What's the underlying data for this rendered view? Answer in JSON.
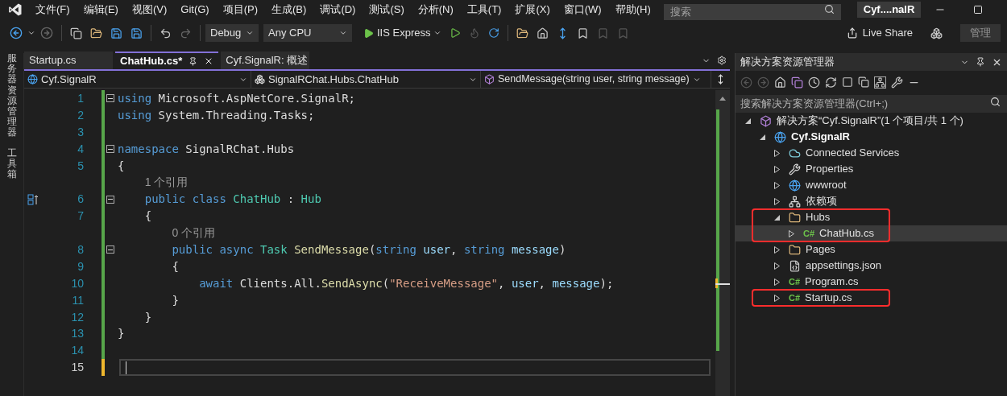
{
  "title_bar": {
    "menus": [
      "文件(F)",
      "编辑(E)",
      "视图(V)",
      "Git(G)",
      "项目(P)",
      "生成(B)",
      "调试(D)",
      "测试(S)",
      "分析(N)",
      "工具(T)",
      "扩展(X)",
      "窗口(W)",
      "帮助(H)"
    ],
    "search": {
      "placeholder": "搜索"
    },
    "solution_name": "Cyf....nalR"
  },
  "toolbar": {
    "configuration": "Debug",
    "platform": "Any CPU",
    "run_target": "IIS Express",
    "live_share": "Live Share",
    "admin": "管理"
  },
  "side_tabs": [
    "服务器资源管理器",
    "工具箱"
  ],
  "editor": {
    "tabs": [
      {
        "label": "Startup.cs",
        "selected": false
      },
      {
        "label": "ChatHub.cs*",
        "selected": true
      },
      {
        "label": "Cyf.SignalR: 概述",
        "selected": false
      }
    ],
    "nav": {
      "project": "Cyf.SignalR",
      "type": "SignalRChat.Hubs.ChatHub",
      "member": "SendMessage(string user, string message)"
    },
    "lines": [
      {
        "kind": "code",
        "number": "1",
        "saved": true,
        "foldable": true,
        "current": false,
        "tokens": [
          {
            "kind": "kw",
            "text": "using"
          },
          {
            "kind": "plain",
            "text": " Microsoft.AspNetCore.SignalR;"
          }
        ]
      },
      {
        "kind": "code",
        "number": "2",
        "saved": true,
        "foldable": false,
        "current": false,
        "tokens": [
          {
            "kind": "kw",
            "text": "using"
          },
          {
            "kind": "plain",
            "text": " System.Threading.Tasks;"
          }
        ]
      },
      {
        "kind": "code",
        "number": "3",
        "saved": true,
        "foldable": false,
        "current": false
      },
      {
        "kind": "code",
        "number": "4",
        "saved": true,
        "foldable": true,
        "current": false,
        "tokens": [
          {
            "kind": "kw",
            "text": "namespace"
          },
          {
            "kind": "plain",
            "text": " SignalRChat.Hubs"
          }
        ]
      },
      {
        "kind": "code",
        "number": "5",
        "saved": true,
        "foldable": false,
        "current": false,
        "tokens": [
          {
            "kind": "plain",
            "text": "{"
          }
        ]
      },
      {
        "kind": "lens",
        "text": "1 个引用"
      },
      {
        "kind": "code",
        "number": "6",
        "saved": true,
        "foldable": true,
        "current": false,
        "gutter_icon": true,
        "tokens": [
          {
            "kind": "kw",
            "text": "    public class"
          },
          {
            "kind": "type",
            "text": " ChatHub"
          },
          {
            "kind": "plain",
            "text": " : "
          },
          {
            "kind": "type",
            "text": "Hub"
          }
        ]
      },
      {
        "kind": "code",
        "number": "7",
        "saved": true,
        "foldable": false,
        "current": false,
        "tokens": [
          {
            "kind": "plain",
            "text": "    {"
          }
        ]
      },
      {
        "kind": "lens",
        "text": "0 个引用"
      },
      {
        "kind": "code",
        "number": "8",
        "saved": true,
        "foldable": true,
        "current": false,
        "tokens": [
          {
            "kind": "kw",
            "text": "        public async"
          },
          {
            "kind": "type",
            "text": " Task"
          },
          {
            "kind": "method",
            "text": " SendMessage"
          },
          {
            "kind": "plain",
            "text": "("
          },
          {
            "kind": "kw",
            "text": "string"
          },
          {
            "kind": "param",
            "text": " user"
          },
          {
            "kind": "plain",
            "text": ", "
          },
          {
            "kind": "kw",
            "text": "string"
          },
          {
            "kind": "param",
            "text": " message"
          },
          {
            "kind": "plain",
            "text": ")"
          }
        ]
      },
      {
        "kind": "code",
        "number": "9",
        "saved": true,
        "foldable": false,
        "current": false,
        "tokens": [
          {
            "kind": "plain",
            "text": "        {"
          }
        ]
      },
      {
        "kind": "code",
        "number": "10",
        "saved": true,
        "foldable": false,
        "current": false,
        "tokens": [
          {
            "kind": "kw",
            "text": "            await"
          },
          {
            "kind": "plain",
            "text": " Clients.All."
          },
          {
            "kind": "method",
            "text": "SendAsync"
          },
          {
            "kind": "plain",
            "text": "("
          },
          {
            "kind": "str",
            "text": "\"ReceiveMessage\""
          },
          {
            "kind": "plain",
            "text": ", "
          },
          {
            "kind": "param",
            "text": "user"
          },
          {
            "kind": "plain",
            "text": ", "
          },
          {
            "kind": "param",
            "text": "message"
          },
          {
            "kind": "plain",
            "text": ");"
          }
        ]
      },
      {
        "kind": "code",
        "number": "11",
        "saved": true,
        "foldable": false,
        "current": false,
        "tokens": [
          {
            "kind": "plain",
            "text": "        }"
          }
        ]
      },
      {
        "kind": "code",
        "number": "12",
        "saved": true,
        "foldable": false,
        "current": false,
        "tokens": [
          {
            "kind": "plain",
            "text": "    }"
          }
        ]
      },
      {
        "kind": "code",
        "number": "13",
        "saved": true,
        "foldable": false,
        "current": false,
        "tokens": [
          {
            "kind": "plain",
            "text": "}"
          }
        ]
      },
      {
        "kind": "code",
        "number": "14",
        "saved": true,
        "foldable": false,
        "current": false
      },
      {
        "kind": "code",
        "number": "15",
        "saved": false,
        "foldable": false,
        "current": true
      }
    ]
  },
  "solution_explorer": {
    "title": "解决方案资源管理器",
    "search": {
      "placeholder": "搜索解决方案资源管理器(Ctrl+;)"
    },
    "tree": [
      {
        "label": "解决方案“Cyf.SignalR”(1 个项目/共 1 个)",
        "kind": "solution",
        "expanded": true,
        "selected": false,
        "highlighted": false,
        "children": [
          {
            "label": "Cyf.SignalR",
            "kind": "project",
            "expanded": true,
            "selected": false,
            "highlighted": false,
            "children": [
              {
                "label": "Connected Services",
                "kind": "connected",
                "expanded": false,
                "selected": false,
                "highlighted": false
              },
              {
                "label": "Properties",
                "kind": "properties",
                "expanded": false,
                "selected": false,
                "highlighted": false
              },
              {
                "label": "wwwroot",
                "kind": "globe",
                "expanded": false,
                "selected": false,
                "highlighted": false
              },
              {
                "label": "依赖项",
                "kind": "deps",
                "expanded": false,
                "selected": false,
                "highlighted": false
              },
              {
                "label": "Hubs",
                "kind": "folder",
                "expanded": true,
                "selected": false,
                "highlighted": true,
                "children": [
                  {
                    "label": "ChatHub.cs",
                    "kind": "csharp",
                    "icon_text": "C#",
                    "expanded": false,
                    "selected": true,
                    "highlighted": false
                  }
                ]
              },
              {
                "label": "Pages",
                "kind": "folder",
                "expanded": false,
                "selected": false,
                "highlighted": false
              },
              {
                "label": "appsettings.json",
                "kind": "json",
                "expanded": false,
                "selected": false,
                "highlighted": false
              },
              {
                "label": "Program.cs",
                "kind": "csharp",
                "icon_text": "C#",
                "expanded": false,
                "selected": false,
                "highlighted": false
              },
              {
                "label": "Startup.cs",
                "kind": "csharp",
                "icon_text": "C#",
                "expanded": false,
                "selected": false,
                "highlighted": true
              }
            ]
          }
        ]
      }
    ]
  }
}
